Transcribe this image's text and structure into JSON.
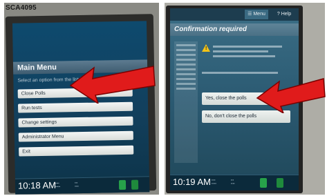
{
  "left": {
    "device_label": "SCA4095",
    "menu_title": "Main Menu",
    "instructions": "Select an option from the list below",
    "buttons": [
      "Close Polls",
      "Run tests",
      "Change settings",
      "Administrator Menu",
      "Exit"
    ],
    "clock": "10:18 AM"
  },
  "right": {
    "menu_label": "☰ Menu",
    "help_label": "? Help",
    "title": "Confirmation required",
    "yes_label": "Yes, close the polls",
    "no_label": "No, don't close the polls",
    "clock": "10:19 AM"
  },
  "colors": {
    "arrow": "#e01b1b",
    "screen": "#0e4a6e"
  },
  "icons": [
    "arrow-icon",
    "warning-icon",
    "power-icon"
  ]
}
